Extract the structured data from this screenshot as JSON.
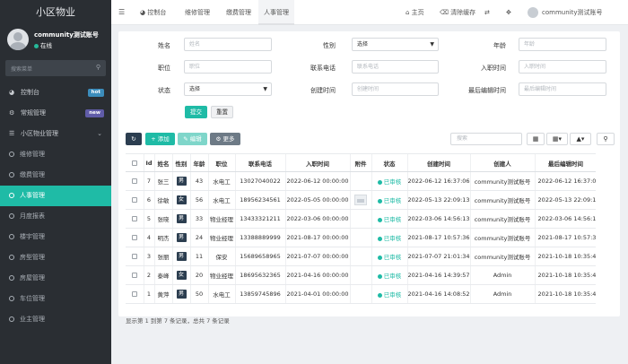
{
  "app": {
    "title": "小区物业"
  },
  "user": {
    "name": "community测试账号",
    "status": "在线"
  },
  "sidebar": {
    "search_placeholder": "搜索菜单",
    "items": [
      {
        "label": "控制台",
        "icon": "dashboard-icon",
        "badge": "hot",
        "badge_color": "#3c8dbc"
      },
      {
        "label": "常规管理",
        "icon": "gear-icon",
        "badge": "new",
        "badge_color": "#605ca8"
      },
      {
        "label": "小区物业管理",
        "icon": "list-icon",
        "expanded": true
      }
    ],
    "subitems": [
      {
        "label": "维修管理"
      },
      {
        "label": "缴费管理"
      },
      {
        "label": "人事管理",
        "active": true
      },
      {
        "label": "月度报表"
      },
      {
        "label": "楼宇管理"
      },
      {
        "label": "房型管理"
      },
      {
        "label": "房屋管理"
      },
      {
        "label": "车位管理"
      },
      {
        "label": "业主管理"
      }
    ]
  },
  "topbar": {
    "tabs": [
      "控制台",
      "维修管理",
      "缴费管理",
      "人事管理"
    ],
    "active_tab": "人事管理",
    "home": "主页",
    "clear_cache": "清除缓存",
    "user": "community测试账号"
  },
  "filters": {
    "name_label": "姓名",
    "name_placeholder": "姓名",
    "sex_label": "性别",
    "sex_value": "选择",
    "age_label": "年龄",
    "age_placeholder": "年龄",
    "position_label": "职位",
    "position_placeholder": "职位",
    "phone_label": "联系电话",
    "phone_placeholder": "联系电话",
    "entry_label": "入职时间",
    "entry_placeholder": "入职时间",
    "status_label": "状态",
    "status_value": "选择",
    "create_label": "创建时间",
    "create_placeholder": "创建时间",
    "edit_label": "最后编辑时间",
    "edit_placeholder": "最后编辑时间",
    "submit": "提交",
    "reset": "重置"
  },
  "toolbar": {
    "add": "添加",
    "edit": "编辑",
    "more": "更多",
    "search_placeholder": "搜索"
  },
  "table": {
    "headers": [
      "Id",
      "姓名",
      "性别",
      "年龄",
      "职位",
      "联系电话",
      "入职时间",
      "附件",
      "状态",
      "创建时间",
      "创建人",
      "最后编辑时间"
    ],
    "rows": [
      {
        "id": "7",
        "name": "张三",
        "sex": "男",
        "age": "43",
        "position": "水电工",
        "phone": "13027040022",
        "entry": "2022-06-12 00:00:00",
        "attach": "",
        "status": "已审核",
        "created": "2022-06-12 16:37:06",
        "creator": "community测试账号",
        "edited": "2022-06-12 16:37:0"
      },
      {
        "id": "6",
        "name": "徐敏",
        "sex": "女",
        "age": "56",
        "position": "水电工",
        "phone": "18956234561",
        "entry": "2022-05-05 00:00:00",
        "attach": "thumb",
        "status": "已审核",
        "created": "2022-05-13 22:09:13",
        "creator": "community测试账号",
        "edited": "2022-05-13 22:09:1"
      },
      {
        "id": "5",
        "name": "张晓",
        "sex": "男",
        "age": "33",
        "position": "物业经理",
        "phone": "13433321211",
        "entry": "2022-03-06 00:00:00",
        "attach": "",
        "status": "已审核",
        "created": "2022-03-06 14:56:13",
        "creator": "community测试账号",
        "edited": "2022-03-06 14:56:1"
      },
      {
        "id": "4",
        "name": "明杰",
        "sex": "男",
        "age": "24",
        "position": "物业经理",
        "phone": "13388889999",
        "entry": "2021-08-17 00:00:00",
        "attach": "",
        "status": "已审核",
        "created": "2021-08-17 10:57:36",
        "creator": "community测试账号",
        "edited": "2021-08-17 10:57:3"
      },
      {
        "id": "3",
        "name": "张丽",
        "sex": "男",
        "age": "11",
        "position": "保安",
        "phone": "15689658965",
        "entry": "2021-07-07 00:00:00",
        "attach": "",
        "status": "已审核",
        "created": "2021-07-07 21:01:34",
        "creator": "community测试账号",
        "edited": "2021-10-18 10:35:4"
      },
      {
        "id": "2",
        "name": "泰峰",
        "sex": "女",
        "age": "20",
        "position": "物业经理",
        "phone": "18695632365",
        "entry": "2021-04-16 00:00:00",
        "attach": "",
        "status": "已审核",
        "created": "2021-04-16 14:39:57",
        "creator": "Admin",
        "edited": "2021-10-18 10:35:4"
      },
      {
        "id": "1",
        "name": "黄萍",
        "sex": "男",
        "age": "50",
        "position": "水电工",
        "phone": "13859745896",
        "entry": "2021-04-01 00:00:00",
        "attach": "",
        "status": "已审核",
        "created": "2021-04-16 14:08:52",
        "creator": "Admin",
        "edited": "2021-10-18 10:35:4"
      }
    ]
  },
  "pagination": {
    "info": "显示第 1 到第 7 条记录，总共 7 条记录"
  },
  "colors": {
    "accent": "#1fbba6",
    "sidebar": "#2a2e33",
    "dark_button": "#2c3e50"
  }
}
